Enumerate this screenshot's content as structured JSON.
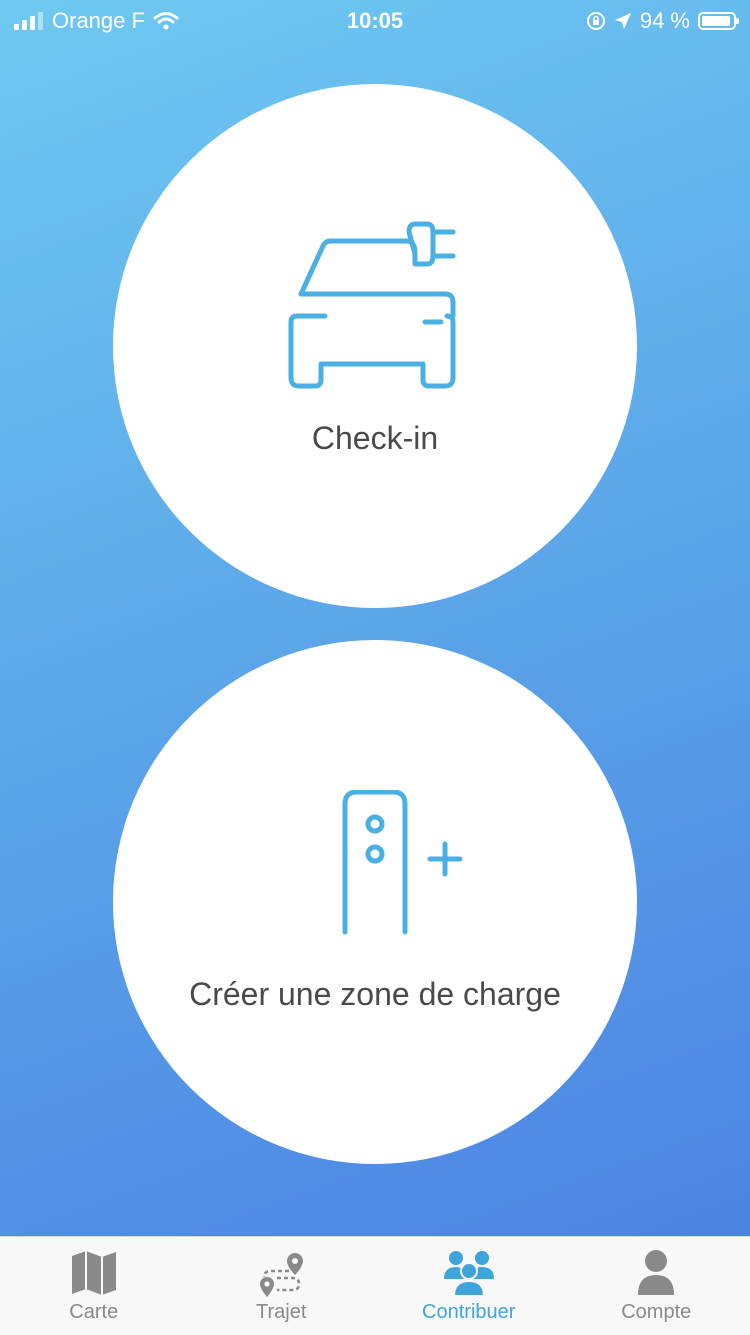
{
  "status_bar": {
    "carrier": "Orange F",
    "time": "10:05",
    "battery_percent": "94 %",
    "battery_level": 0.94,
    "icons": [
      "signal-icon",
      "wifi-icon",
      "orientation-lock-icon",
      "location-arrow-icon",
      "battery-icon"
    ]
  },
  "actions": {
    "checkin": {
      "label": "Check-in",
      "icon": "car-charging-icon"
    },
    "create_zone": {
      "label": "Créer une zone de charge",
      "icon": "charging-station-add-icon"
    }
  },
  "tabs": [
    {
      "label": "Carte",
      "icon": "map-icon",
      "active": false
    },
    {
      "label": "Trajet",
      "icon": "route-icon",
      "active": false
    },
    {
      "label": "Contribuer",
      "icon": "community-icon",
      "active": true
    },
    {
      "label": "Compte",
      "icon": "user-icon",
      "active": false
    }
  ],
  "colors": {
    "accent": "#4ab0e3",
    "tab_active": "#3fa4dc",
    "tab_inactive": "#8a8a8a",
    "gradient_top": "#6ec9f1",
    "gradient_bottom": "#4a7fe3"
  }
}
